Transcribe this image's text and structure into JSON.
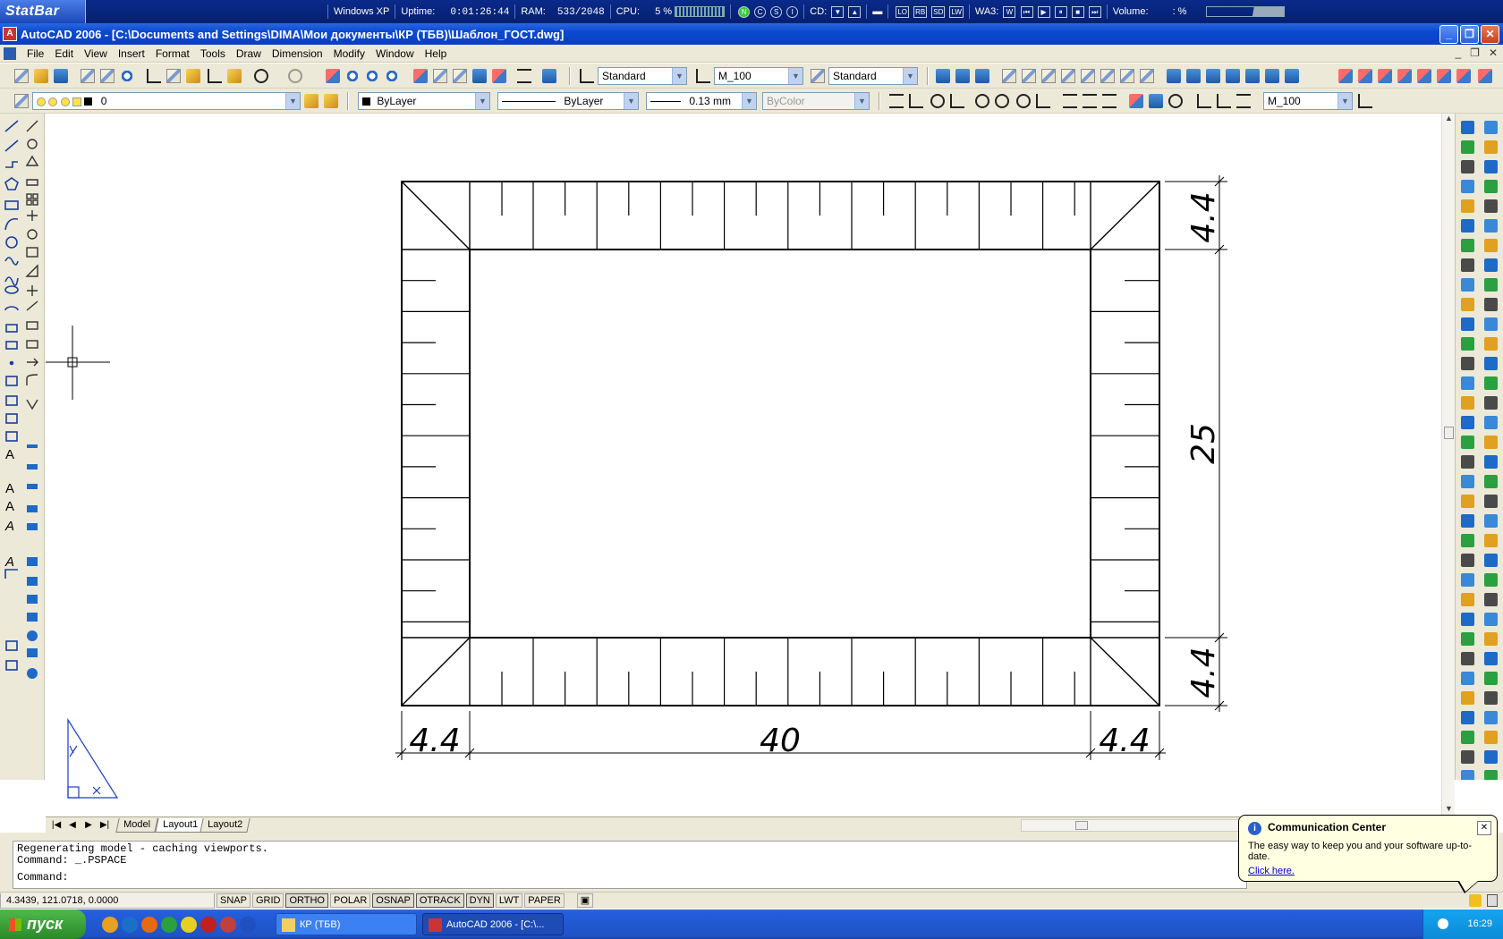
{
  "statbar": {
    "brand": "StatBar",
    "os": "Windows XP",
    "uptime_label": "Uptime:",
    "uptime_value": "0:01:26:44",
    "ram_label": "RAM:",
    "ram_value": "533/2048",
    "cpu_label": "CPU:",
    "cpu_value": "5 %",
    "cd_label": "CD:",
    "wa_label": "WA3:",
    "volume_label": "Volume:",
    "volume_value": ": %",
    "disk_labels": [
      "LO",
      "RB",
      "SD",
      "LW"
    ],
    "indicator_letters": [
      "N",
      "C",
      "S",
      "I"
    ]
  },
  "window": {
    "title": "AutoCAD 2006 - [C:\\Documents and Settings\\DIMA\\Мои документы\\КР (ТБВ)\\Шаблон_ГОСТ.dwg]",
    "min": "_",
    "max": "❐",
    "close": "✕"
  },
  "menu": [
    "File",
    "Edit",
    "View",
    "Insert",
    "Format",
    "Tools",
    "Draw",
    "Dimension",
    "Modify",
    "Window",
    "Help"
  ],
  "toolbar1": {
    "text_style": "Standard",
    "dim_style": "M_100",
    "table_style": "Standard"
  },
  "toolbar2": {
    "layer": "0",
    "color": "ByLayer",
    "linetype": "ByLayer",
    "lineweight": "0.13 mm",
    "plotstyle": "ByColor",
    "dim_style2": "M_100"
  },
  "drawing": {
    "dim_top": "4.4",
    "dim_middle": "25",
    "dim_bottom": "4.4",
    "dim_left": "4.4",
    "dim_width": "40",
    "dim_right": "4.4"
  },
  "tabs": [
    "Model",
    "Layout1",
    "Layout2"
  ],
  "command": {
    "line1": "Regenerating model - caching viewports.",
    "line2": "Command: _.PSPACE",
    "line3": "Command:"
  },
  "status": {
    "coords": "4.3439, 121.0718, 0.0000",
    "buttons": [
      "SNAP",
      "GRID",
      "ORTHO",
      "POLAR",
      "OSNAP",
      "OTRACK",
      "DYN",
      "LWT",
      "PAPER"
    ]
  },
  "balloon": {
    "title": "Communication Center",
    "body": "The easy way to keep you and your software up-to-date.",
    "link": "Click here."
  },
  "taskbar": {
    "start": "пуск",
    "tasks": [
      "КР (ТБВ)",
      "AutoCAD 2006 - [C:\\..."
    ],
    "clock": "16:29"
  },
  "colors": {
    "xp_blue": "#0a4ad0",
    "face": "#ece9d8",
    "start_green": "#2a8a28"
  }
}
